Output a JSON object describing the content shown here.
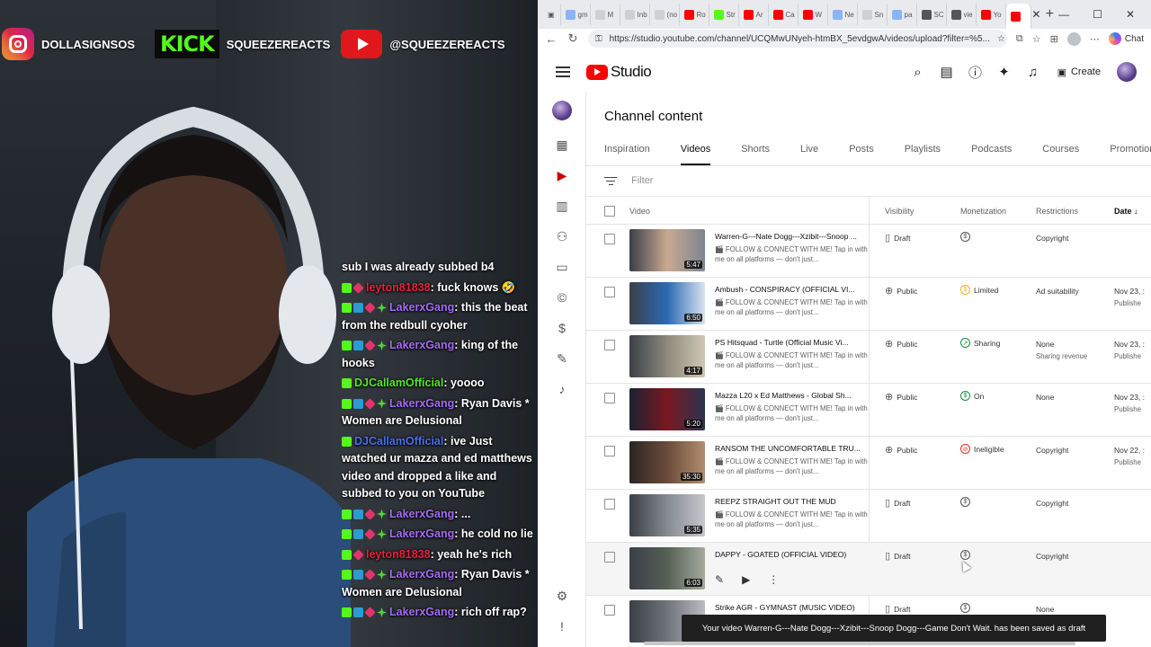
{
  "stream": {
    "socials": [
      {
        "handle": "DOLLASIGNSOS",
        "icon": "instagram-icon"
      },
      {
        "handle": "SQUEEZEREACTS",
        "icon": "kick-logo",
        "logo_text": "KICK"
      },
      {
        "handle": "@SQUEEZEREACTS",
        "icon": "youtube-icon"
      }
    ],
    "chat": [
      {
        "badges": [],
        "user": "",
        "text": "sub I was already subbed b4"
      },
      {
        "badges": [
          "k",
          "r"
        ],
        "user": "leyton81838",
        "user_color": "u1",
        "text": ": fuck knows 🤣"
      },
      {
        "badges": [
          "k",
          "s",
          "r",
          "g"
        ],
        "user": "LakerxGang",
        "user_color": "u2",
        "text": ": this the beat from the redbull cyoher"
      },
      {
        "badges": [
          "k",
          "s",
          "r",
          "g"
        ],
        "user": "LakerxGang",
        "user_color": "u2",
        "text": ": king of the hooks"
      },
      {
        "badges": [
          "k"
        ],
        "user": "DJCallamOfficial",
        "user_color": "u3",
        "text": ": yoooo"
      },
      {
        "badges": [
          "k",
          "s",
          "r",
          "g"
        ],
        "user": "LakerxGang",
        "user_color": "u2",
        "text": ": Ryan Davis * Women are Delusional"
      },
      {
        "badges": [
          "k"
        ],
        "user": "DJCallamOfficial",
        "user_color": "u4",
        "text": ": ive Just watched ur mazza and ed matthews video and dropped a like and subbed to you on YouTube"
      },
      {
        "badges": [
          "k",
          "s",
          "r",
          "g"
        ],
        "user": "LakerxGang",
        "user_color": "u2",
        "text": ": ..."
      },
      {
        "badges": [
          "k",
          "s",
          "r",
          "g"
        ],
        "user": "LakerxGang",
        "user_color": "u2",
        "text": ": he cold no lie"
      },
      {
        "badges": [
          "k",
          "r"
        ],
        "user": "leyton81838",
        "user_color": "u1",
        "text": ": yeah he's rich"
      },
      {
        "badges": [
          "k",
          "s",
          "r",
          "g"
        ],
        "user": "LakerxGang",
        "user_color": "u2",
        "text": ": Ryan Davis * Women are Delusional"
      },
      {
        "badges": [
          "k",
          "s",
          "r",
          "g"
        ],
        "user": "LakerxGang",
        "user_color": "u2",
        "text": ": rich off rap?"
      }
    ]
  },
  "browser": {
    "url": "https://studio.youtube.com/channel/UCQMwUNyeh-htmBX_5evdgwA/videos/upload?filter=%5...",
    "tabs": [
      {
        "label": "gm",
        "color": "#8ab4f8"
      },
      {
        "label": "M",
        "color": "#d0d0d0"
      },
      {
        "label": "Inb",
        "color": "#d0d0d0"
      },
      {
        "label": "(no",
        "color": "#d0d0d0"
      },
      {
        "label": "Ro",
        "color": "#ff0000"
      },
      {
        "label": "Str",
        "color": "#53fc18"
      },
      {
        "label": "Ar",
        "color": "#ff0000"
      },
      {
        "label": "Ca",
        "color": "#ff0000"
      },
      {
        "label": "W",
        "color": "#ff0000"
      },
      {
        "label": "Ne",
        "color": "#8ab4f8"
      },
      {
        "label": "Sn",
        "color": "#d0d0d0"
      },
      {
        "label": "pa",
        "color": "#8ab4f8"
      },
      {
        "label": "SC",
        "color": "#555555"
      },
      {
        "label": "vie",
        "color": "#555555"
      },
      {
        "label": "Yo",
        "color": "#ff0000"
      }
    ],
    "chat_label": "Chat"
  },
  "studio": {
    "logo_text": "Studio",
    "create_label": "Create",
    "page_title": "Channel content",
    "tabs": [
      "Inspiration",
      "Videos",
      "Shorts",
      "Live",
      "Posts",
      "Playlists",
      "Podcasts",
      "Courses",
      "Promotions"
    ],
    "active_tab": "Videos",
    "filter_placeholder": "Filter",
    "columns": {
      "video": "Video",
      "visibility": "Visibility",
      "monetization": "Monetization",
      "restrictions": "Restrictions",
      "date": "Date"
    },
    "videos": [
      {
        "title": "Warren-G---Nate Dogg---Xzibit---Snoop ...",
        "desc": "🎬 FOLLOW & CONNECT WITH ME! Tap in with me on all platforms — don't just...",
        "duration": "5:47",
        "visibility": "Draft",
        "monetization": "",
        "restrictions": "Copyright",
        "restrictions_sub": "",
        "date": "",
        "date_sub": "",
        "thumb": [
          "#3a3f47",
          "#c9a991",
          "#7d8590"
        ]
      },
      {
        "title": "Ambush - CONSPIRACY (OFFICIAL VI...",
        "desc": "🎬 FOLLOW & CONNECT WITH ME! Tap in with me on all platforms — don't just...",
        "duration": "6:50",
        "visibility": "Public",
        "monetization": "Limited",
        "restrictions": "Ad suitability",
        "restrictions_sub": "",
        "date": "Nov 23, :",
        "date_sub": "Publishe",
        "thumb": [
          "#3b4048",
          "#2a6ab4",
          "#d9e3f0"
        ]
      },
      {
        "title": "PS Hitsquad - Turtle (Official Music Vi...",
        "desc": "🎬 FOLLOW & CONNECT WITH ME! Tap in with me on all platforms — don't just...",
        "duration": "4:17",
        "visibility": "Public",
        "monetization": "Sharing",
        "restrictions": "None",
        "restrictions_sub": "Sharing revenue",
        "date": "Nov 23, :",
        "date_sub": "Publishe",
        "thumb": [
          "#3b4048",
          "#8d8a7c",
          "#cfc7b4"
        ]
      },
      {
        "title": "Mazza L20 x Ed Matthews - Global Sh...",
        "desc": "🎬 FOLLOW & CONNECT WITH ME! Tap in with me on all platforms — don't just...",
        "duration": "5:20",
        "visibility": "Public",
        "monetization": "On",
        "restrictions": "None",
        "restrictions_sub": "",
        "date": "Nov 23, :",
        "date_sub": "Publishe",
        "thumb": [
          "#1b2232",
          "#7a1820",
          "#2b3550"
        ]
      },
      {
        "title": "RANSOM THE UNCOMFORTABLE TRU...",
        "desc": "🎬 FOLLOW & CONNECT WITH ME! Tap in with me on all platforms — don't just...",
        "duration": "35:30",
        "visibility": "Public",
        "monetization": "Ineligible",
        "restrictions": "Copyright",
        "restrictions_sub": "",
        "date": "Nov 22, :",
        "date_sub": "Publishe",
        "thumb": [
          "#2a2522",
          "#6b4b3a",
          "#b18e6f"
        ]
      },
      {
        "title": "REEPZ  STRAIGHT OUT THE MUD",
        "desc": "🎬 FOLLOW & CONNECT WITH ME! Tap in with me on all platforms — don't just...",
        "duration": "5:35",
        "visibility": "Draft",
        "monetization": "",
        "restrictions": "Copyright",
        "restrictions_sub": "",
        "date": "",
        "date_sub": "",
        "thumb": [
          "#3a3f47",
          "#868a91",
          "#c5c8cc"
        ]
      },
      {
        "title": "DAPPY - GOATED (OFFICIAL VIDEO)",
        "desc": "",
        "duration": "6:03",
        "visibility": "Draft",
        "monetization": "",
        "restrictions": "Copyright",
        "restrictions_sub": "",
        "date": "",
        "date_sub": "",
        "thumb": [
          "#3a3f47",
          "#566055",
          "#a5aa9e"
        ]
      },
      {
        "title": "Strike AGR - GYMNAST (MUSIC VIDEO)",
        "desc": "",
        "duration": "",
        "visibility": "Draft",
        "monetization": "",
        "restrictions": "None",
        "restrictions_sub": "",
        "date": "",
        "date_sub": "",
        "thumb": [
          "#3a3f47",
          "#6f737a",
          "#b9bcc0"
        ]
      }
    ],
    "toast": "Your video Warren-G---Nate Dogg---Xzibit---Snoop Dogg---Game Don't Wait. has been saved as draft"
  }
}
